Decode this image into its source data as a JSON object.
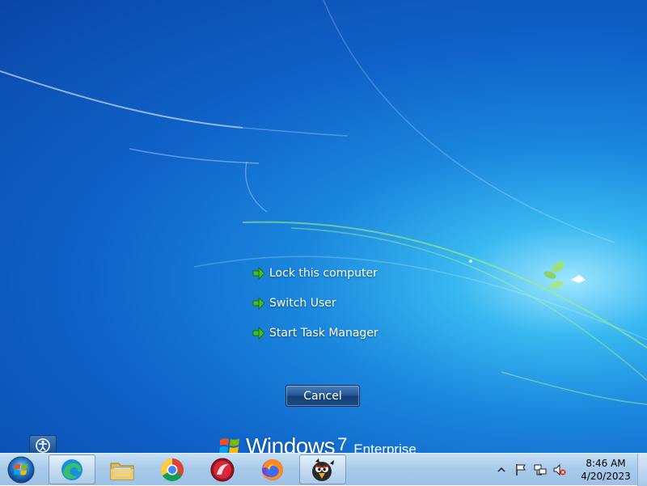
{
  "security_screen": {
    "options": [
      {
        "label": "Lock this computer",
        "icon": "green-arrow-icon"
      },
      {
        "label": "Switch User",
        "icon": "green-arrow-icon"
      },
      {
        "label": "Start Task Manager",
        "icon": "green-arrow-icon"
      }
    ],
    "cancel_label": "Cancel",
    "ease_of_access_icon": "ease-of-access-icon"
  },
  "branding": {
    "product": "Windows",
    "version": "7",
    "edition": "Enterprise"
  },
  "taskbar": {
    "start_icon": "windows-start-orb-icon",
    "pinned": [
      {
        "name": "edge",
        "icon": "edge-icon",
        "active": true
      },
      {
        "name": "file-explorer",
        "icon": "folder-icon",
        "active": false
      },
      {
        "name": "chrome",
        "icon": "chrome-icon",
        "active": false
      },
      {
        "name": "app-red",
        "icon": "red-circle-app-icon",
        "active": false
      },
      {
        "name": "firefox",
        "icon": "firefox-icon",
        "active": false
      },
      {
        "name": "game",
        "icon": "angry-bird-icon",
        "active": true
      }
    ],
    "tray_icons": [
      "show-hidden-icons-chevron",
      "action-center-flag-icon",
      "network-icon",
      "volume-muted-icon"
    ],
    "clock": {
      "time": "8:46 AM",
      "date": "4/20/2023"
    }
  },
  "colors": {
    "desktop_blue": "#0f62c8",
    "desktop_highlight": "#9fe6ff",
    "taskbar": "#a9cbea",
    "arrow_green": "#3fbf2f"
  }
}
